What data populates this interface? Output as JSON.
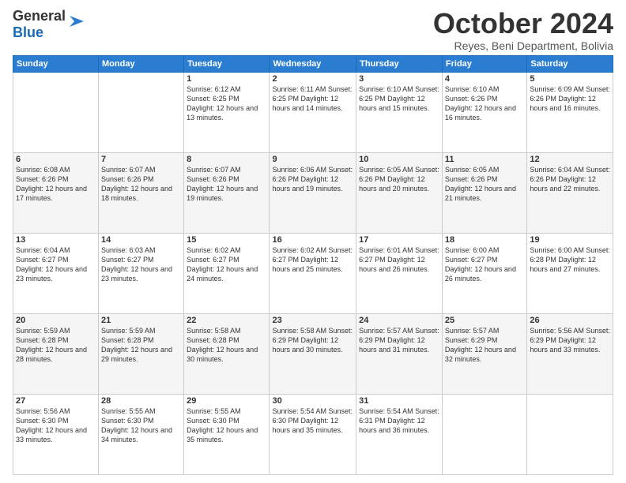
{
  "logo": {
    "general": "General",
    "blue": "Blue"
  },
  "header": {
    "month": "October 2024",
    "subtitle": "Reyes, Beni Department, Bolivia"
  },
  "days_of_week": [
    "Sunday",
    "Monday",
    "Tuesday",
    "Wednesday",
    "Thursday",
    "Friday",
    "Saturday"
  ],
  "weeks": [
    [
      {
        "day": "",
        "info": ""
      },
      {
        "day": "",
        "info": ""
      },
      {
        "day": "1",
        "info": "Sunrise: 6:12 AM\nSunset: 6:25 PM\nDaylight: 12 hours and 13 minutes."
      },
      {
        "day": "2",
        "info": "Sunrise: 6:11 AM\nSunset: 6:25 PM\nDaylight: 12 hours and 14 minutes."
      },
      {
        "day": "3",
        "info": "Sunrise: 6:10 AM\nSunset: 6:25 PM\nDaylight: 12 hours and 15 minutes."
      },
      {
        "day": "4",
        "info": "Sunrise: 6:10 AM\nSunset: 6:26 PM\nDaylight: 12 hours and 16 minutes."
      },
      {
        "day": "5",
        "info": "Sunrise: 6:09 AM\nSunset: 6:26 PM\nDaylight: 12 hours and 16 minutes."
      }
    ],
    [
      {
        "day": "6",
        "info": "Sunrise: 6:08 AM\nSunset: 6:26 PM\nDaylight: 12 hours and 17 minutes."
      },
      {
        "day": "7",
        "info": "Sunrise: 6:07 AM\nSunset: 6:26 PM\nDaylight: 12 hours and 18 minutes."
      },
      {
        "day": "8",
        "info": "Sunrise: 6:07 AM\nSunset: 6:26 PM\nDaylight: 12 hours and 19 minutes."
      },
      {
        "day": "9",
        "info": "Sunrise: 6:06 AM\nSunset: 6:26 PM\nDaylight: 12 hours and 19 minutes."
      },
      {
        "day": "10",
        "info": "Sunrise: 6:05 AM\nSunset: 6:26 PM\nDaylight: 12 hours and 20 minutes."
      },
      {
        "day": "11",
        "info": "Sunrise: 6:05 AM\nSunset: 6:26 PM\nDaylight: 12 hours and 21 minutes."
      },
      {
        "day": "12",
        "info": "Sunrise: 6:04 AM\nSunset: 6:26 PM\nDaylight: 12 hours and 22 minutes."
      }
    ],
    [
      {
        "day": "13",
        "info": "Sunrise: 6:04 AM\nSunset: 6:27 PM\nDaylight: 12 hours and 23 minutes."
      },
      {
        "day": "14",
        "info": "Sunrise: 6:03 AM\nSunset: 6:27 PM\nDaylight: 12 hours and 23 minutes."
      },
      {
        "day": "15",
        "info": "Sunrise: 6:02 AM\nSunset: 6:27 PM\nDaylight: 12 hours and 24 minutes."
      },
      {
        "day": "16",
        "info": "Sunrise: 6:02 AM\nSunset: 6:27 PM\nDaylight: 12 hours and 25 minutes."
      },
      {
        "day": "17",
        "info": "Sunrise: 6:01 AM\nSunset: 6:27 PM\nDaylight: 12 hours and 26 minutes."
      },
      {
        "day": "18",
        "info": "Sunrise: 6:00 AM\nSunset: 6:27 PM\nDaylight: 12 hours and 26 minutes."
      },
      {
        "day": "19",
        "info": "Sunrise: 6:00 AM\nSunset: 6:28 PM\nDaylight: 12 hours and 27 minutes."
      }
    ],
    [
      {
        "day": "20",
        "info": "Sunrise: 5:59 AM\nSunset: 6:28 PM\nDaylight: 12 hours and 28 minutes."
      },
      {
        "day": "21",
        "info": "Sunrise: 5:59 AM\nSunset: 6:28 PM\nDaylight: 12 hours and 29 minutes."
      },
      {
        "day": "22",
        "info": "Sunrise: 5:58 AM\nSunset: 6:28 PM\nDaylight: 12 hours and 30 minutes."
      },
      {
        "day": "23",
        "info": "Sunrise: 5:58 AM\nSunset: 6:29 PM\nDaylight: 12 hours and 30 minutes."
      },
      {
        "day": "24",
        "info": "Sunrise: 5:57 AM\nSunset: 6:29 PM\nDaylight: 12 hours and 31 minutes."
      },
      {
        "day": "25",
        "info": "Sunrise: 5:57 AM\nSunset: 6:29 PM\nDaylight: 12 hours and 32 minutes."
      },
      {
        "day": "26",
        "info": "Sunrise: 5:56 AM\nSunset: 6:29 PM\nDaylight: 12 hours and 33 minutes."
      }
    ],
    [
      {
        "day": "27",
        "info": "Sunrise: 5:56 AM\nSunset: 6:30 PM\nDaylight: 12 hours and 33 minutes."
      },
      {
        "day": "28",
        "info": "Sunrise: 5:55 AM\nSunset: 6:30 PM\nDaylight: 12 hours and 34 minutes."
      },
      {
        "day": "29",
        "info": "Sunrise: 5:55 AM\nSunset: 6:30 PM\nDaylight: 12 hours and 35 minutes."
      },
      {
        "day": "30",
        "info": "Sunrise: 5:54 AM\nSunset: 6:30 PM\nDaylight: 12 hours and 35 minutes."
      },
      {
        "day": "31",
        "info": "Sunrise: 5:54 AM\nSunset: 6:31 PM\nDaylight: 12 hours and 36 minutes."
      },
      {
        "day": "",
        "info": ""
      },
      {
        "day": "",
        "info": ""
      }
    ]
  ]
}
